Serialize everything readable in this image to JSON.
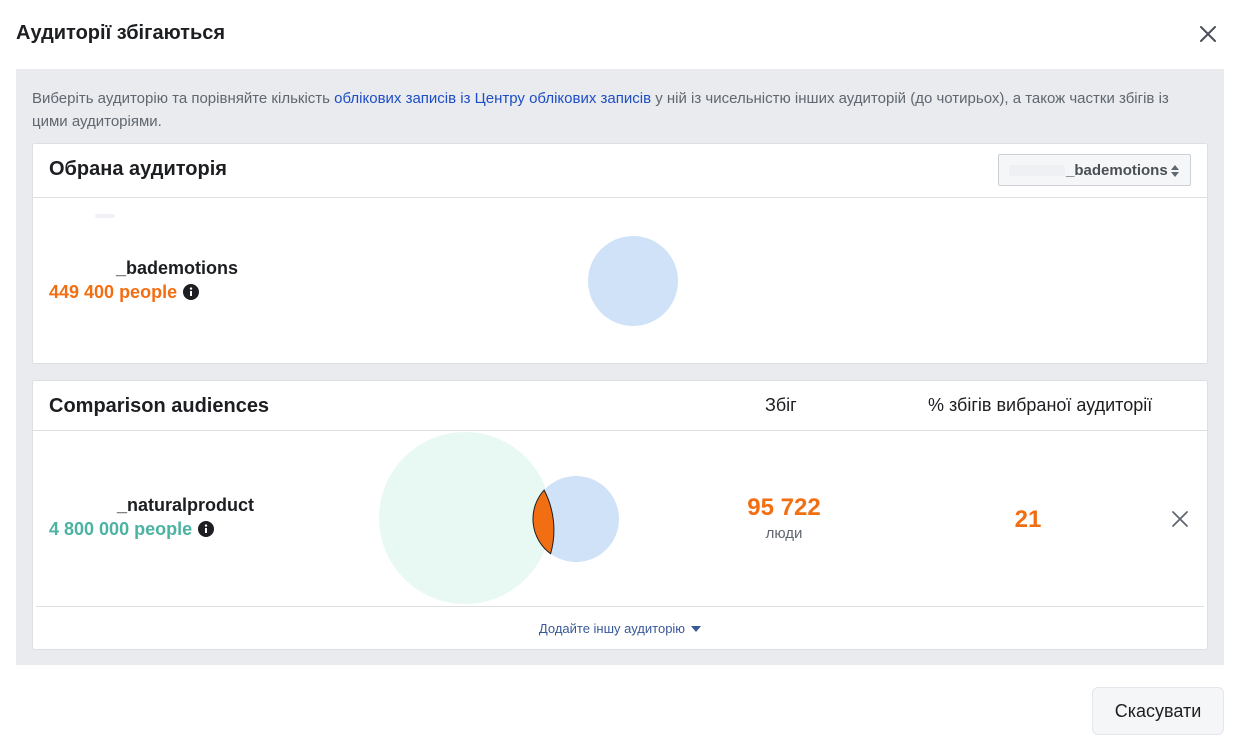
{
  "dialog": {
    "title": "Аудиторії збігаються",
    "cancel_label": "Скасувати"
  },
  "intro": {
    "text_before": "Виберіть аудиторію та порівняйте кількість ",
    "link_text": "облікових записів із Центру облікових записів",
    "text_after": " у ній із чисельністю інших аудиторій (до чотирьох), а також частки збігів із цими аудиторіями."
  },
  "selected": {
    "title": "Обрана аудиторія",
    "dropdown_value": "_bademotions",
    "audience_name": "_bademotions",
    "audience_count": "449 400 people",
    "count_color": "#f26e12",
    "circle_color": "#cfe2f8"
  },
  "comparison": {
    "title": "Comparison audiences",
    "col_overlap": "Збіг",
    "col_percent": "% збігів вибраної аудиторії",
    "rows": [
      {
        "name": "_naturalproduct",
        "count": "4 800 000 people",
        "count_color": "#4cb3a3",
        "overlap_value": "95 722",
        "overlap_unit": "люди",
        "percent": "21"
      }
    ],
    "add_label": "Додайте іншу аудиторію"
  },
  "colors": {
    "accent_orange": "#f26e12",
    "teal": "#4cb3a3",
    "link_blue": "#1d4ec6",
    "panel_bg": "#e9ebee"
  },
  "icons": {
    "close": "close-icon",
    "info": "info-icon",
    "updown": "sort-arrows-icon",
    "remove": "remove-icon",
    "caret": "caret-down-icon"
  }
}
